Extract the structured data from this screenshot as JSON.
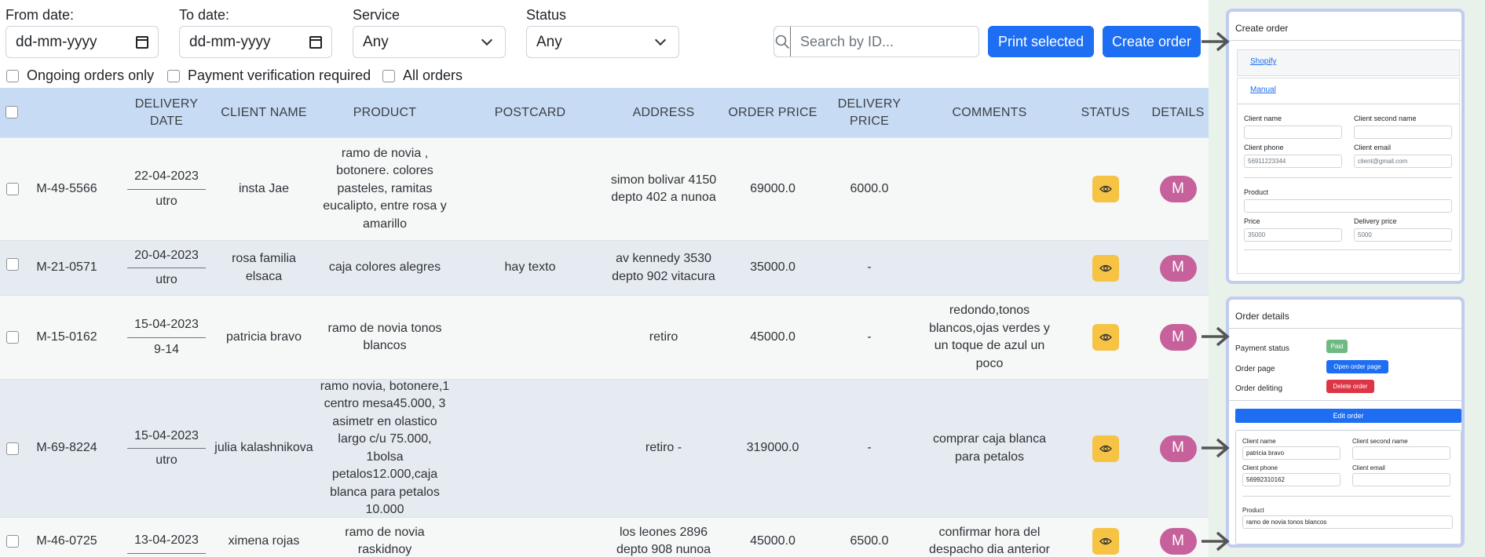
{
  "filters": {
    "from_label": "From date:",
    "from_value": "dd-mm-yyyy",
    "to_label": "To date:",
    "to_value": "dd-mm-yyyy",
    "service_label": "Service",
    "service_value": "Any",
    "status_label": "Status",
    "status_value": "Any",
    "search_placeholder": "Search by ID...",
    "print_label": "Print selected",
    "create_label": "Create order",
    "ongoing_label": "Ongoing orders only",
    "payment_label": "Payment verification required",
    "all_label": "All orders"
  },
  "table": {
    "headers": {
      "delivery_date": "DELIVERY DATE",
      "client_name": "CLIENT NAME",
      "product": "PRODUCT",
      "postcard": "POSTCARD",
      "address": "ADDRESS",
      "order_price": "ORDER PRICE",
      "delivery_price": "DELIVERY PRICE",
      "comments": "COMMENTS",
      "status": "STATUS",
      "details": "DETAILS"
    },
    "rows": [
      {
        "id": "M-49-5566",
        "date": "22-04-2023",
        "slot": "utro",
        "client": "insta Jae",
        "product": "ramo de novia , botonere. colores pasteles, ramitas eucalipto, entre rosa y amarillo",
        "postcard": "",
        "address": "simon bolivar 4150 depto 402 a nunoa",
        "order_price": "69000.0",
        "delivery_price": "6000.0",
        "comments": "",
        "details_label": "M"
      },
      {
        "id": "M-21-0571",
        "date": "20-04-2023",
        "slot": "utro",
        "client": "rosa familia elsaca",
        "product": "caja colores alegres",
        "postcard": "hay texto",
        "address": "av kennedy 3530 depto 902 vitacura",
        "order_price": "35000.0",
        "delivery_price": "-",
        "comments": "",
        "details_label": "M"
      },
      {
        "id": "M-15-0162",
        "date": "15-04-2023",
        "slot": "9-14",
        "client": "patricia bravo",
        "product": "ramo de novia tonos blancos",
        "postcard": "",
        "address": "retiro",
        "order_price": "45000.0",
        "delivery_price": "-",
        "comments": "redondo,tonos blancos,ojas verdes y un toque de azul un poco",
        "details_label": "M"
      },
      {
        "id": "M-69-8224",
        "date": "15-04-2023",
        "slot": "utro",
        "client": "julia kalashnikova",
        "product": "ramo novia, botonere,1 centro mesa45.000, 3 asimetr en olastico largo c/u 75.000, 1bolsa petalos12.000,caja blanca para petalos 10.000",
        "postcard": "",
        "address": "retiro -",
        "order_price": "319000.0",
        "delivery_price": "-",
        "comments": "comprar caja blanca para petalos",
        "details_label": "M"
      },
      {
        "id": "M-46-0725",
        "date": "13-04-2023",
        "slot": "",
        "client": "ximena rojas",
        "product": "ramo de novia raskidnoy",
        "postcard": "",
        "address": "los leones 2896 depto 908 nunoa",
        "order_price": "45000.0",
        "delivery_price": "6500.0",
        "comments": "confirmar hora del despacho dia anterior",
        "details_label": "M"
      }
    ]
  },
  "create_panel": {
    "title": "Create order",
    "tab_shopify": "Shopify",
    "tab_manual": "Manual",
    "client_name_label": "Client name",
    "client_second_name_label": "Client second name",
    "client_phone_label": "Client phone",
    "client_phone_placeholder": "56911223344",
    "client_email_label": "Client email",
    "client_email_placeholder": "client@gmail.com",
    "product_label": "Product",
    "price_label": "Price",
    "price_placeholder": "35000",
    "delivery_price_label": "Delivery price",
    "delivery_price_placeholder": "5000"
  },
  "details_panel": {
    "title": "Order details",
    "payment_status_label": "Payment status",
    "payment_status_value": "Paid",
    "order_page_label": "Order page",
    "open_order_label": "Open order page",
    "order_deleting_label": "Order deliting",
    "delete_label": "Delete order",
    "edit_label": "Edit order",
    "client_name_label": "Client name",
    "client_name_value": "patricia bravo",
    "client_second_name_label": "Client second name",
    "client_phone_label": "Client phone",
    "client_phone_value": "56992310162",
    "client_email_label": "Client email",
    "product_label": "Product",
    "product_value": "ramo de novia tonos blancos"
  },
  "colors": {
    "primary": "#1d6ef2",
    "header_bg": "#c7dcf4",
    "status_eye": "#f6c344",
    "details_badge": "#c7619c",
    "paid_badge": "#6fba82",
    "delete_badge": "#dc3545"
  },
  "icons": {
    "search": "search-icon",
    "eye": "eye-icon",
    "calendar": "calendar-icon",
    "arrow": "arrow-right-icon"
  }
}
